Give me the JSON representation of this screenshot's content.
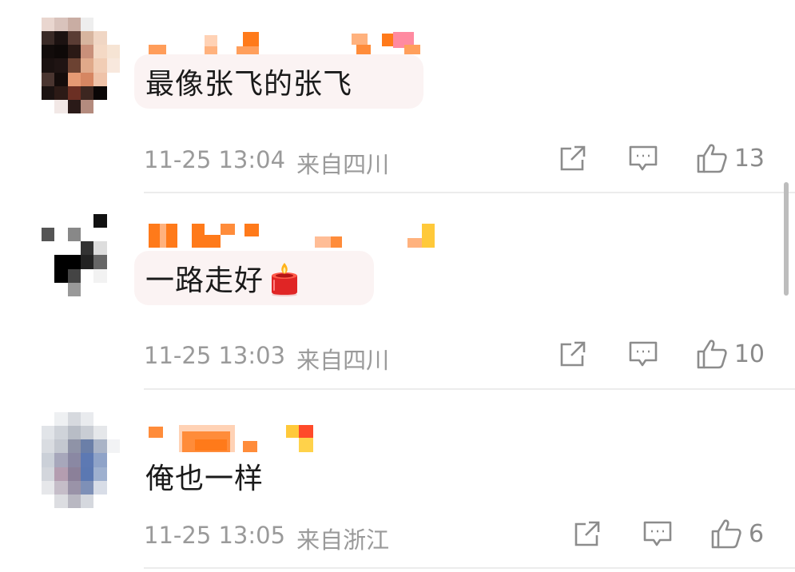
{
  "comments": [
    {
      "text": "最像张飞的张飞",
      "time": "11-25 13:04",
      "location": "来自四川",
      "likes": "13",
      "has_candle": false
    },
    {
      "text": "一路走好",
      "time": "11-25 13:03",
      "location": "来自四川",
      "likes": "10",
      "has_candle": true,
      "candle_icon": "candle-emoji"
    },
    {
      "text": "俺也一样",
      "time": "11-25 13:05",
      "location": "来自浙江",
      "likes": "6",
      "has_candle": false
    }
  ],
  "icons": {
    "repost": "repost-icon",
    "reply": "comment-icon",
    "like": "thumbs-up-icon"
  },
  "colors": {
    "username_orange": "#ff7a1a",
    "meta_gray": "#9a9a9a",
    "bubble_bg": "#fbf3f3"
  }
}
